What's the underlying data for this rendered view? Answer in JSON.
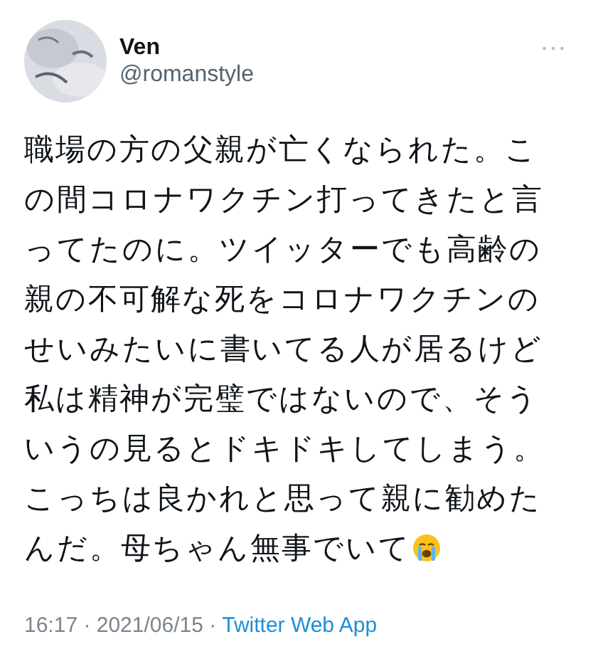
{
  "author": {
    "name": "Ven",
    "handle": "@romanstyle"
  },
  "tweet": {
    "text": "職場の方の父親が亡くなられた。この間コロナワクチン打ってきたと言ってたのに。ツイッターでも高齢の親の不可解な死をコロナワクチンのせいみたいに書いてる人が居るけど私は精神が完璧ではないので、そういうの見るとドキドキしてしまう。こっちは良かれと思って親に勧めたんだ。母ちゃん無事でいて"
  },
  "meta": {
    "time": "16:17",
    "separator": "·",
    "date": "2021/06/15",
    "source": "Twitter Web App"
  }
}
